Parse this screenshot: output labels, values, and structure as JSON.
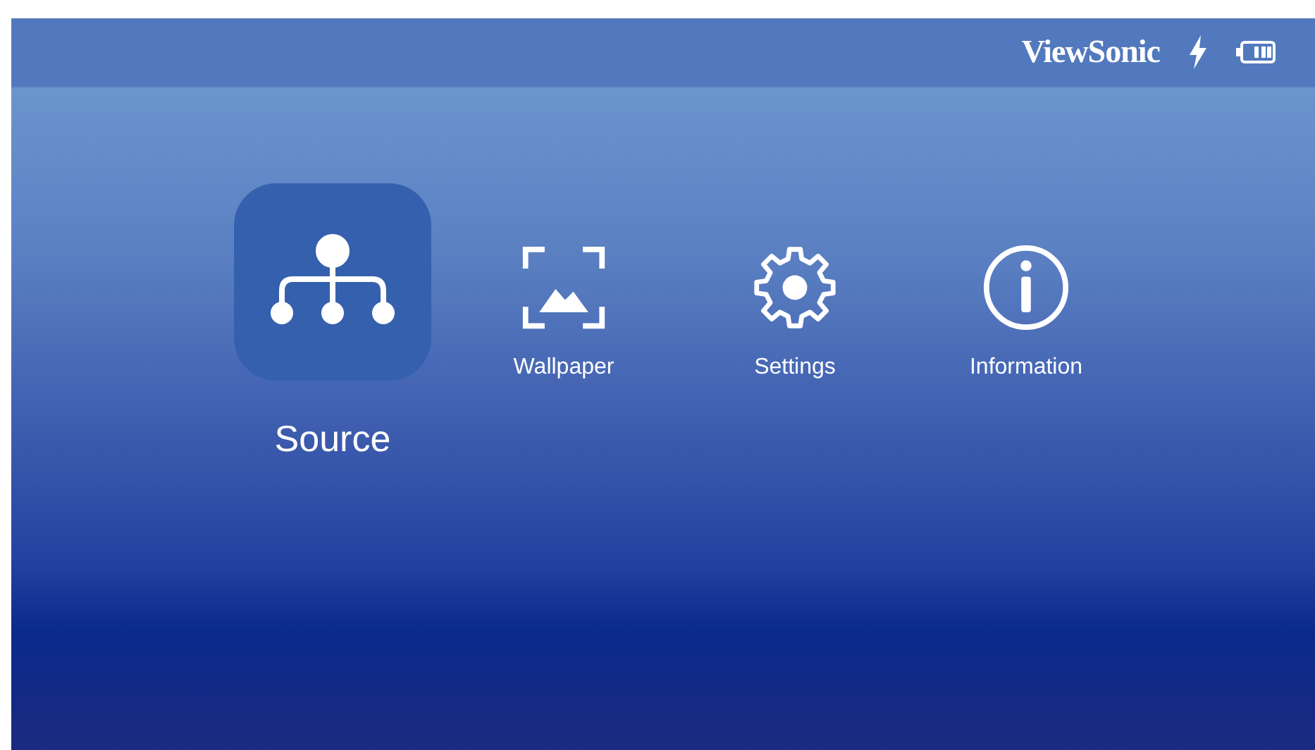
{
  "status_bar": {
    "brand": "ViewSonic"
  },
  "menu": [
    {
      "label": "Source",
      "kind": "source",
      "selected": true
    },
    {
      "label": "Wallpaper",
      "kind": "wallpaper",
      "selected": false
    },
    {
      "label": "Settings",
      "kind": "settings",
      "selected": false
    },
    {
      "label": "Information",
      "kind": "information",
      "selected": false
    }
  ]
}
